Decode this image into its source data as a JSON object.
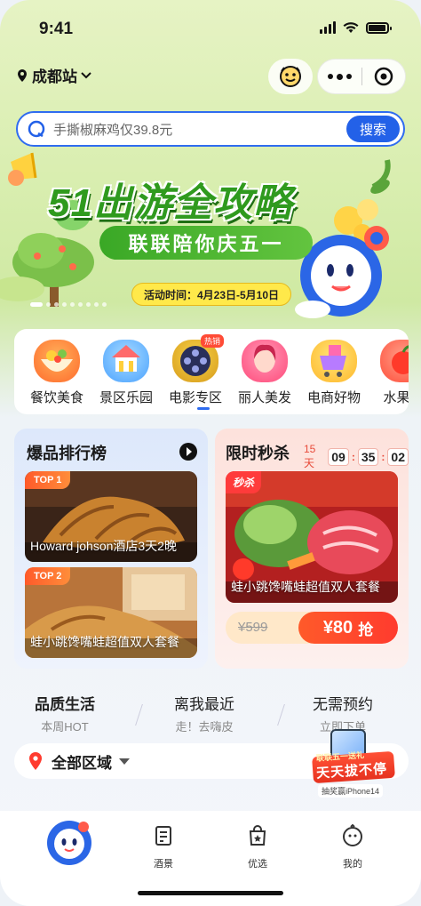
{
  "status": {
    "time": "9:41"
  },
  "header": {
    "city": "成都站"
  },
  "search": {
    "placeholder": "手撕椒麻鸡仅39.8元",
    "button": "搜索"
  },
  "banner": {
    "title": "51出游全攻略",
    "subtitle": "联联陪你庆五一",
    "date": "活动时间：4月23日-5月10日"
  },
  "categories": [
    {
      "label": "餐饮美食",
      "icon": "food-bowl-icon",
      "color": "#ff7a3d"
    },
    {
      "label": "景区乐园",
      "icon": "carousel-icon",
      "color": "#5aa7ff"
    },
    {
      "label": "电影专区",
      "icon": "film-reel-icon",
      "color": "#3f4b9a",
      "badge": "热销"
    },
    {
      "label": "丽人美发",
      "icon": "beauty-icon",
      "color": "#ff5a8a"
    },
    {
      "label": "电商好物",
      "icon": "shopping-cart-icon",
      "color": "#ffb938"
    },
    {
      "label": "水果生",
      "icon": "fruit-icon",
      "color": "#ff4e3a"
    }
  ],
  "ranking": {
    "title": "爆品排行榜",
    "items": [
      {
        "tag": "TOP 1",
        "caption": "Howard johson酒店3天2晚"
      },
      {
        "tag": "TOP 2",
        "caption": "蛙小跳馋嘴蛙超值双人套餐"
      }
    ]
  },
  "flash": {
    "title": "限时秒杀",
    "days": "15天",
    "hh": "09",
    "mm": "35",
    "ss": "02",
    "tag": "秒杀",
    "caption": "蛙小跳馋嘴蛙超值双人套餐",
    "original_price": "¥599",
    "price": "¥80",
    "buy_label": "抢"
  },
  "quality_tabs": [
    {
      "title": "品质生活",
      "sub": "本周HOT"
    },
    {
      "title": "离我最近",
      "sub": "走！去嗨皮"
    },
    {
      "title": "无需预约",
      "sub": "立即下单"
    }
  ],
  "area_filter": {
    "label": "全部区域"
  },
  "promo": {
    "ribbon": "联联五一送礼",
    "main": "天天拔不停",
    "foot": "抽奖赢iPhone14"
  },
  "tabbar": [
    {
      "label": "",
      "icon": "mascot-home-icon"
    },
    {
      "label": "酒景",
      "icon": "hotel-icon"
    },
    {
      "label": "优选",
      "icon": "shopping-bag-icon"
    },
    {
      "label": "我的",
      "icon": "profile-face-icon"
    }
  ],
  "colors": {
    "primary": "#2361e8",
    "accent": "#ff3b2e",
    "green": "#2f9a1e"
  }
}
